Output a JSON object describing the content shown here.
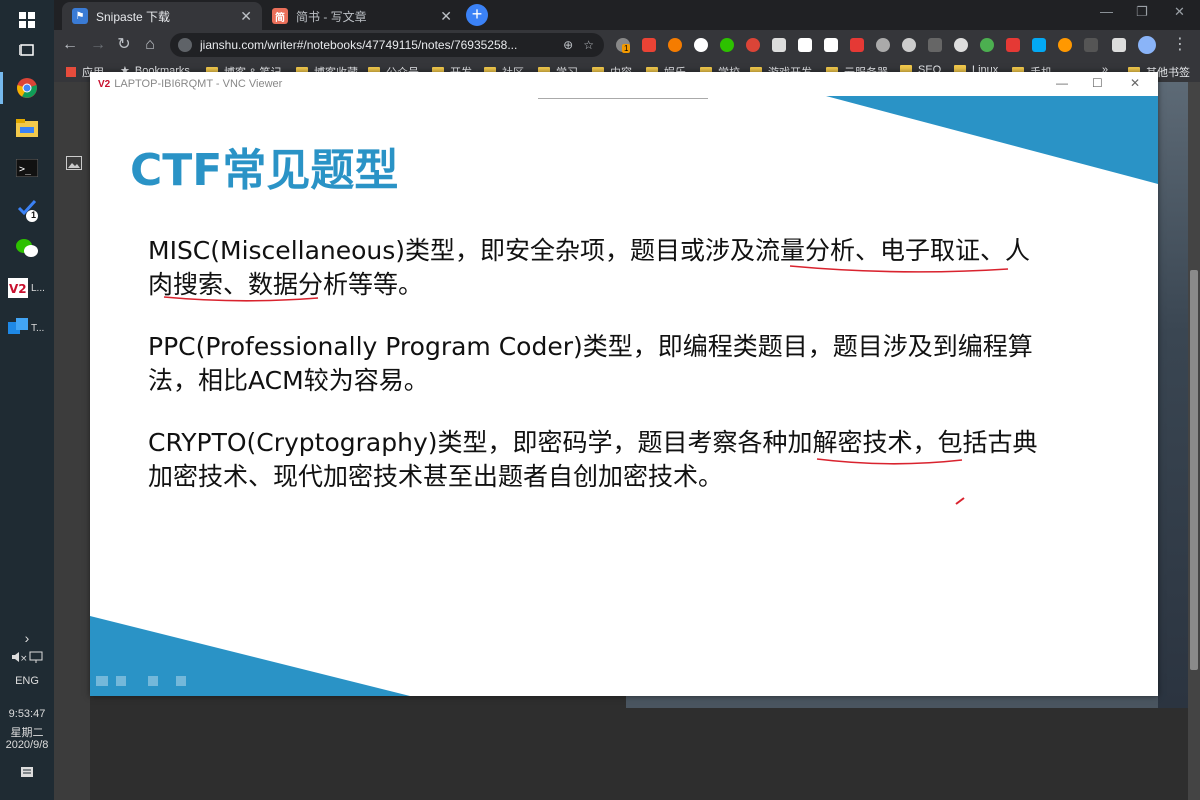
{
  "taskbar": {
    "items": [
      {
        "name": "windows-start-icon",
        "label": ""
      },
      {
        "name": "task-view-icon",
        "label": ""
      },
      {
        "name": "chrome-app",
        "label": ""
      },
      {
        "name": "file-explorer-app",
        "label": ""
      },
      {
        "name": "terminal-app",
        "label": ""
      },
      {
        "name": "todo-app",
        "label": ""
      },
      {
        "name": "wechat-app",
        "label": ""
      },
      {
        "name": "vnc-viewer-app",
        "label": "L..."
      },
      {
        "name": "tablet-app",
        "label": "T..."
      }
    ],
    "todo_badge": "1",
    "language": "ENG",
    "time": "9:53:47",
    "weekday": "星期二",
    "date": "2020/9/8"
  },
  "browser": {
    "tabs": [
      {
        "title": "Snipaste 下载",
        "icon": "bookmark-icon",
        "active": true
      },
      {
        "title": "简书 - 写文章",
        "icon": "jianshu-icon",
        "active": false
      }
    ],
    "url": "jianshu.com/writer#/notebooks/47749115/notes/76935258...",
    "bookmarks": [
      "应用",
      "Bookmarks",
      "博客 & 笔记",
      "博客收藏",
      "公众号",
      "开发",
      "社区",
      "学习",
      "内容",
      "娱乐",
      "学校",
      "游戏开发",
      "云服务器",
      "SEO",
      "Linux",
      "手机",
      "其他书签"
    ],
    "ext_badge": "1",
    "bookmarks_overflow": "»"
  },
  "vnc": {
    "title": "LAPTOP-IBI6RQMT - VNC Viewer",
    "logo": "V2"
  },
  "slide": {
    "heading": "CTF常见题型",
    "paragraphs": [
      {
        "line1": "MISC(Miscellaneous)类型，即安全杂项，题目或涉及流量分析、电子取证、人",
        "line2": "肉搜索、数据分析等等。"
      },
      {
        "line1": "PPC(Professionally Program Coder)类型，即编程类题目，题目涉及到编程算",
        "line2": "法，相比ACM较为容易。"
      },
      {
        "line1": "CRYPTO(Cryptography)类型，即密码学，题目考察各种加解密技术，包括古典",
        "line2": "加密技术、现代加密技术甚至出题者自创加密技术。"
      }
    ],
    "colors": {
      "accent": "#2a93c6",
      "annotation": "#d9232e"
    }
  }
}
